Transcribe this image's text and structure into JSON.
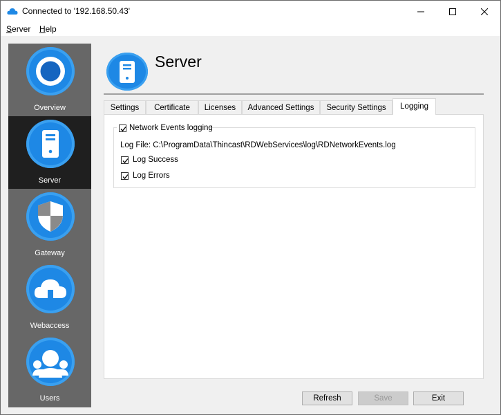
{
  "window": {
    "title": "Connected to '192.168.50.43'",
    "controls": {
      "minimize": "minimize",
      "maximize": "maximize",
      "close": "close"
    }
  },
  "menu": [
    {
      "accel": "S",
      "rest": "erver"
    },
    {
      "accel": "H",
      "rest": "elp"
    }
  ],
  "sidebar": {
    "items": [
      {
        "label": "Overview",
        "icon": "overview-icon",
        "active": false
      },
      {
        "label": "Server",
        "icon": "server-icon",
        "active": true
      },
      {
        "label": "Gateway",
        "icon": "shield-icon",
        "active": false
      },
      {
        "label": "Webaccess",
        "icon": "cloud-icon",
        "active": false
      },
      {
        "label": "Users",
        "icon": "users-icon",
        "active": false
      }
    ]
  },
  "page": {
    "title": "Server",
    "icon": "server-icon"
  },
  "tabs": [
    {
      "label": "Settings",
      "active": false
    },
    {
      "label": "Certificate",
      "active": false
    },
    {
      "label": "Licenses",
      "active": false
    },
    {
      "label": "Advanced Settings",
      "active": false
    },
    {
      "label": "Security Settings",
      "active": false
    },
    {
      "label": "Logging",
      "active": true
    }
  ],
  "logging": {
    "network_events": {
      "label": "Network Events logging",
      "checked": true
    },
    "log_file": "Log File: C:\\ProgramData\\Thincast\\RDWebServices\\log\\RDNetworkEvents.log",
    "log_success": {
      "label": "Log Success",
      "checked": true
    },
    "log_errors": {
      "label": "Log Errors",
      "checked": true
    }
  },
  "buttons": {
    "refresh": "Refresh",
    "save": "Save",
    "save_enabled": false,
    "exit": "Exit"
  },
  "colors": {
    "accent": "#1e88e5",
    "sidebar_bg": "#676767",
    "sidebar_active": "#1f1f1f"
  }
}
